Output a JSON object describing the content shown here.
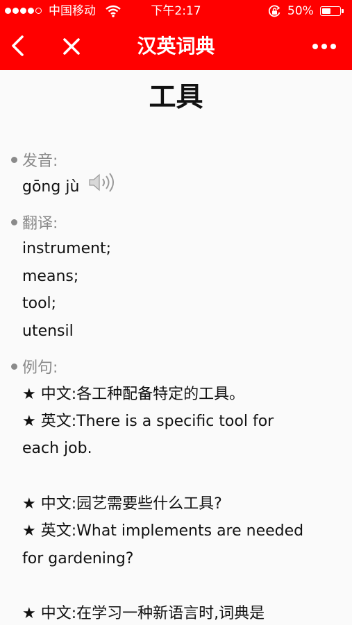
{
  "status_bar": {
    "carrier": "中国移动",
    "time": "下午2:17",
    "battery_percent": "50%",
    "battery_level": 0.5,
    "signal_bars_filled": 4,
    "signal_bars_total": 5
  },
  "nav": {
    "title": "汉英词典",
    "back_icon": "chevron-left-icon",
    "close_icon": "close-icon",
    "more_icon": "more-dots-icon"
  },
  "entry": {
    "word": "工具",
    "pronunciation_label": "发音:",
    "pinyin": "gōng jù",
    "translation_label": "翻译:",
    "translations": [
      "instrument;",
      "means;",
      "tool;",
      "utensil"
    ],
    "examples_label": "例句:",
    "example_lines": [
      "★ 中文:各工种配备特定的工具。",
      "★ 英文:There is a specific tool for",
      "each job.",
      "",
      "★ 中文:园艺需要些什么工具?",
      "★ 英文:What implements are needed",
      "for gardening?",
      "",
      "★ 中文:在学习一种新语言时,词典是"
    ]
  },
  "colors": {
    "brand_red": "#ff0000",
    "label_gray": "#8a8a8a"
  }
}
